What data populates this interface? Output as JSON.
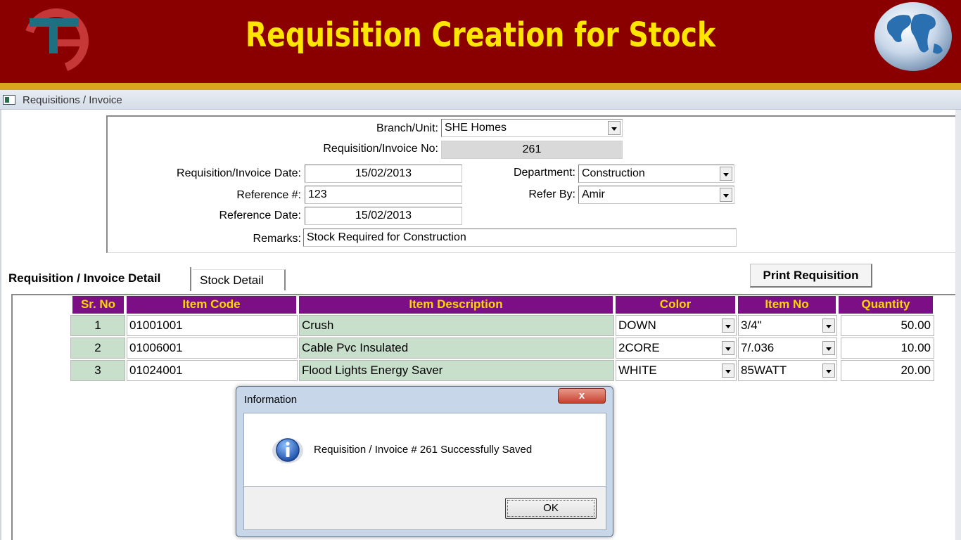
{
  "banner": {
    "title": "Requisition Creation for Stock"
  },
  "window": {
    "title": "Requisitions / Invoice"
  },
  "form": {
    "branch_label": "Branch/Unit:",
    "branch_value": "SHE Homes",
    "reqno_label": "Requisition/Invoice No:",
    "reqno_value": "261",
    "reqdate_label": "Requisition/Invoice Date:",
    "reqdate_value": "15/02/2013",
    "dept_label": "Department:",
    "dept_value": "Construction",
    "ref_label": "Reference #:",
    "ref_value": "123",
    "referby_label": "Refer By:",
    "referby_value": "Amir",
    "refdate_label": "Reference Date:",
    "refdate_value": "15/02/2013",
    "remarks_label": "Remarks:",
    "remarks_value": "Stock Required for Construction"
  },
  "tabs": [
    {
      "label": "Requisition / Invoice Detail",
      "active": true
    },
    {
      "label": "Stock Detail",
      "active": false
    }
  ],
  "print_button": "Print Requisition",
  "grid": {
    "headers": [
      "Sr. No",
      "Item Code",
      "Item Description",
      "Color",
      "Item No",
      "Quantity"
    ],
    "rows": [
      {
        "sr": "1",
        "code": "01001001",
        "desc": "Crush",
        "color": "DOWN",
        "itemno": "3/4\"",
        "qty": "50.00"
      },
      {
        "sr": "2",
        "code": "01006001",
        "desc": "Cable Pvc Insulated",
        "color": "2CORE",
        "itemno": "7/.036",
        "qty": "10.00"
      },
      {
        "sr": "3",
        "code": "01024001",
        "desc": "Flood Lights Energy Saver",
        "color": "WHITE",
        "itemno": "85WATT",
        "qty": "20.00"
      }
    ]
  },
  "dialog": {
    "title": "Information",
    "close_label": "x",
    "message": "Requisition / Invoice # 261 Successfully Saved",
    "ok_label": "OK"
  },
  "colors": {
    "banner": "#8a0000",
    "banner_text": "#ffe600",
    "grid_header": "#7d0f86",
    "grid_header_text": "#ffd700",
    "grid_green": "#c7dfcb"
  }
}
